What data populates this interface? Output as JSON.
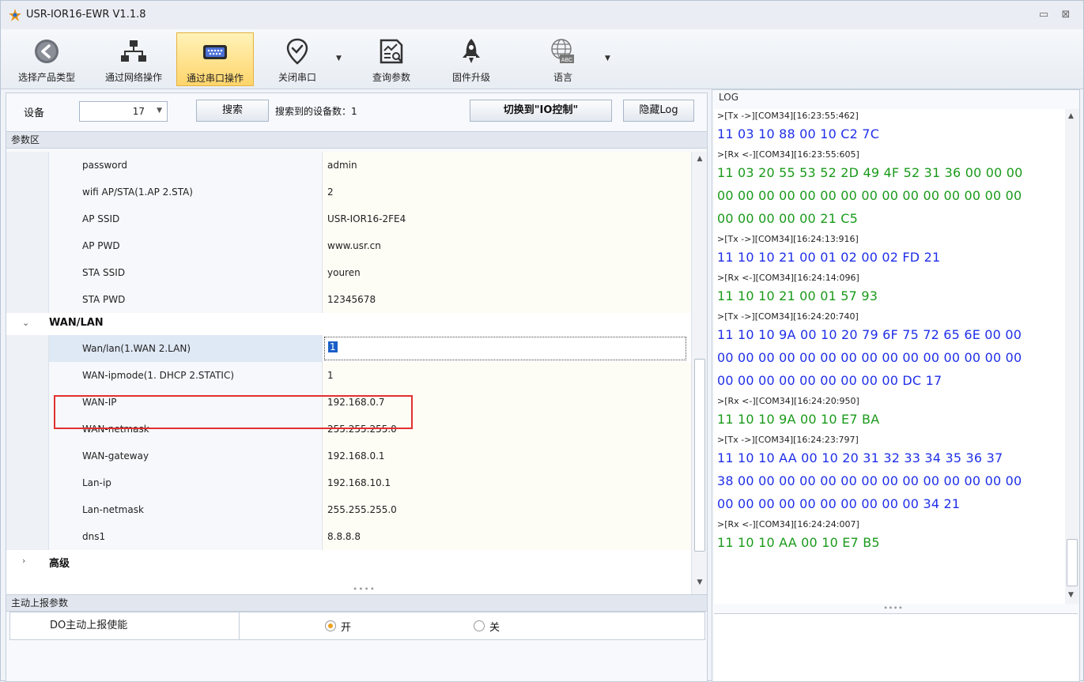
{
  "window": {
    "title": "USR-IOR16-EWR V1.1.8",
    "minimize": "▭",
    "close": "⊠"
  },
  "toolbar": {
    "select_product": "选择产品类型",
    "network_op": "通过网络操作",
    "serial_op": "通过串口操作",
    "close_port": "关闭串口",
    "query_params": "查询参数",
    "firmware_upgrade": "固件升级",
    "language": "语言"
  },
  "search_bar": {
    "device_label": "设备",
    "device_value": "17",
    "search_button": "搜索",
    "found_text": "搜索到的设备数：1",
    "switch_button": "切换到\"IO控制\"",
    "hide_log_button": "隐藏Log"
  },
  "param_area": {
    "title": "参数区",
    "rows": [
      {
        "name": "password",
        "value": "admin"
      },
      {
        "name": "wifi AP/STA(1.AP 2.STA)",
        "value": "2"
      },
      {
        "name": "AP SSID",
        "value": "USR-IOR16-2FE4"
      },
      {
        "name": "AP PWD",
        "value": "www.usr.cn"
      },
      {
        "name": "STA SSID",
        "value": "youren"
      },
      {
        "name": "STA PWD",
        "value": "12345678"
      }
    ],
    "group_wan": "WAN/LAN",
    "wan_rows": [
      {
        "name": "Wan/lan(1.WAN 2.LAN)",
        "value": "1"
      },
      {
        "name": "WAN-ipmode(1. DHCP 2.STATIC)",
        "value": "1"
      },
      {
        "name": "WAN-IP",
        "value": "192.168.0.7"
      },
      {
        "name": "WAN-netmask",
        "value": "255.255.255.0"
      },
      {
        "name": "WAN-gateway",
        "value": "192.168.0.1"
      },
      {
        "name": "Lan-ip",
        "value": "192.168.10.1"
      },
      {
        "name": "Lan-netmask",
        "value": "255.255.255.0"
      },
      {
        "name": "dns1",
        "value": "8.8.8.8"
      }
    ],
    "group_advanced": "高级"
  },
  "report_area": {
    "title": "主动上报参数",
    "row_label": "DO主动上报使能",
    "opt_on": "开",
    "opt_off": "关"
  },
  "log": {
    "title": "LOG",
    "lines": [
      {
        "kind": "meta",
        "text": ">[Tx ->][COM34][16:23:55:462]"
      },
      {
        "kind": "tx",
        "text": "11 03 10 88 00 10 C2 7C"
      },
      {
        "kind": "meta",
        "text": ">[Rx <-][COM34][16:23:55:605]"
      },
      {
        "kind": "rx",
        "text": "11 03 20 55 53 52 2D 49 4F 52 31 36 00 00 00"
      },
      {
        "kind": "rx",
        "text": "00 00 00 00 00 00 00 00 00 00 00 00 00 00 00"
      },
      {
        "kind": "rx",
        "text": "00 00 00 00 00 21 C5"
      },
      {
        "kind": "meta",
        "text": ">[Tx ->][COM34][16:24:13:916]"
      },
      {
        "kind": "tx",
        "text": "11 10 10 21 00 01 02 00 02 FD 21"
      },
      {
        "kind": "meta",
        "text": ">[Rx <-][COM34][16:24:14:096]"
      },
      {
        "kind": "rx",
        "text": "11 10 10 21 00 01 57 93"
      },
      {
        "kind": "meta",
        "text": ">[Tx ->][COM34][16:24:20:740]"
      },
      {
        "kind": "tx",
        "text": "11 10 10 9A 00 10 20 79 6F 75 72 65 6E 00 00"
      },
      {
        "kind": "tx",
        "text": "00 00 00 00 00 00 00 00 00 00 00 00 00 00 00"
      },
      {
        "kind": "tx",
        "text": "00 00 00 00 00 00 00 00 00 DC 17"
      },
      {
        "kind": "meta",
        "text": ">[Rx <-][COM34][16:24:20:950]"
      },
      {
        "kind": "rx",
        "text": "11 10 10 9A 00 10 E7 BA"
      },
      {
        "kind": "meta",
        "text": ">[Tx ->][COM34][16:24:23:797]"
      },
      {
        "kind": "tx",
        "text": "11 10 10 AA 00 10 20 31 32 33 34 35 36 37"
      },
      {
        "kind": "tx",
        "text": "38 00 00 00 00 00 00 00 00 00 00 00 00 00 00"
      },
      {
        "kind": "tx",
        "text": "00 00 00 00 00 00 00 00 00 00 34 21"
      },
      {
        "kind": "meta",
        "text": ">[Rx <-][COM34][16:24:24:007]"
      },
      {
        "kind": "rx",
        "text": "11 10 10 AA 00 10 E7 B5"
      }
    ]
  },
  "colors": {
    "tx": "#1f2fe8",
    "rx": "#1a9a1a",
    "highlight": "#e23030",
    "active_tab": "#ffd56b"
  }
}
